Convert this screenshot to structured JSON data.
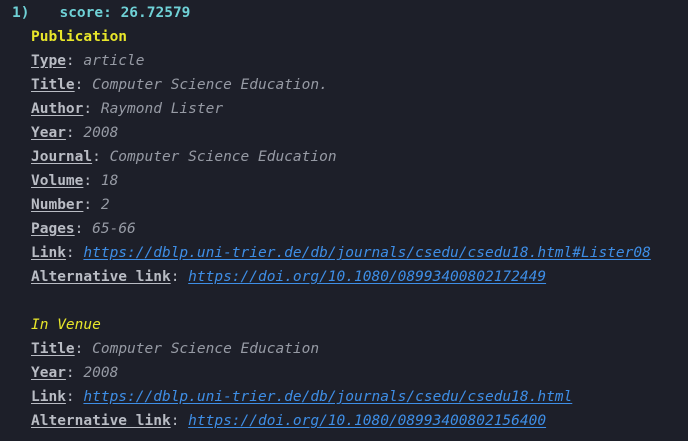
{
  "result": {
    "index": "1)",
    "score_label": "score: 26.72579"
  },
  "publication": {
    "heading": "Publication",
    "fields": [
      {
        "key": "Type",
        "value": "article"
      },
      {
        "key": "Title",
        "value": "Computer Science Education."
      },
      {
        "key": "Author",
        "value": "Raymond Lister"
      },
      {
        "key": "Year",
        "value": "2008"
      },
      {
        "key": "Journal",
        "value": "Computer Science Education"
      },
      {
        "key": "Volume",
        "value": "18"
      },
      {
        "key": "Number",
        "value": "2"
      },
      {
        "key": "Pages",
        "value": "65-66"
      },
      {
        "key": "Link",
        "value": "https://dblp.uni-trier.de/db/journals/csedu/csedu18.html#Lister08"
      },
      {
        "key": "Alternative link",
        "value": "https://doi.org/10.1080/08993400802172449"
      }
    ]
  },
  "venue": {
    "heading": "In Venue",
    "fields": [
      {
        "key": "Title",
        "value": "Computer Science Education"
      },
      {
        "key": "Year",
        "value": "2008"
      },
      {
        "key": "Link",
        "value": "https://dblp.uni-trier.de/db/journals/csedu/csedu18.html"
      },
      {
        "key": "Alternative link",
        "value": "https://doi.org/10.1080/08993400802156400"
      }
    ]
  },
  "colors": {
    "background": "#1d1f29",
    "score": "#6fd1d6",
    "heading": "#e8e62a",
    "link": "#3e8ee6"
  }
}
